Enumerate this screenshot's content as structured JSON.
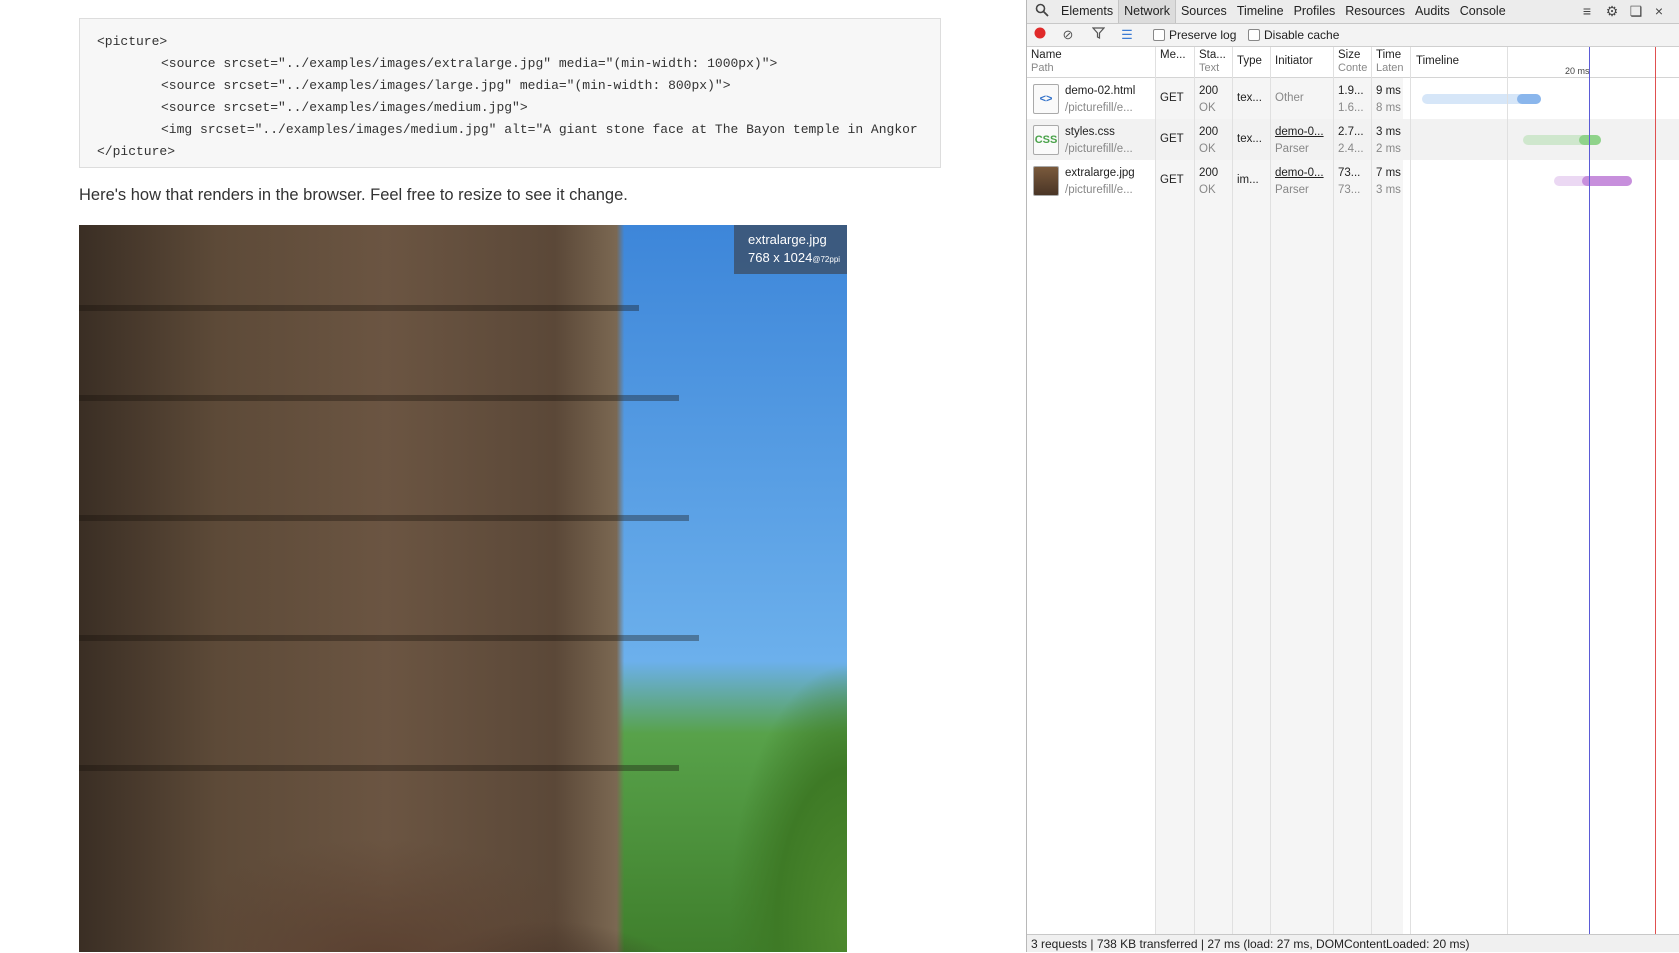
{
  "code_block": {
    "lines": [
      "<picture>",
      "<source srcset=\"../examples/images/extralarge.jpg\" media=\"(min-width: 1000px)\">",
      "<source srcset=\"../examples/images/large.jpg\" media=\"(min-width: 800px)\">",
      "<source srcset=\"../examples/images/medium.jpg\">",
      "<img srcset=\"../examples/images/medium.jpg\" alt=\"A giant stone face at The Bayon temple in Angkor",
      "</picture>"
    ]
  },
  "caption": "Here's how that renders in the browser. Feel free to resize to see it change.",
  "image_badge": {
    "filename": "extralarge.jpg",
    "dimensions": "768 x 1024",
    "ppi": "@72ppi"
  },
  "devtools": {
    "tabs": [
      "Elements",
      "Network",
      "Sources",
      "Timeline",
      "Profiles",
      "Resources",
      "Audits",
      "Console"
    ],
    "active_tab": "Network",
    "icons": {
      "search": "magnifier-icon",
      "drawer": "show-drawer-icon",
      "settings": "gear-icon",
      "dock": "dock-icon",
      "close": "close-icon"
    },
    "filter_bar": {
      "preserve_log": "Preserve log",
      "disable_cache": "Disable cache"
    },
    "columns": [
      {
        "main": "Name",
        "sub": "Path"
      },
      {
        "main": "Me...",
        "sub": ""
      },
      {
        "main": "Sta...",
        "sub": "Text"
      },
      {
        "main": "Type",
        "sub": ""
      },
      {
        "main": "Initiator",
        "sub": ""
      },
      {
        "main": "Size",
        "sub": "Conte"
      },
      {
        "main": "Time",
        "sub": "Laten"
      },
      {
        "main": "Timeline",
        "sub": ""
      }
    ],
    "timeline_tick": "20 ms",
    "rows": [
      {
        "name": "demo-02.html",
        "path": "/picturefill/e...",
        "method": "GET",
        "status": "200",
        "status_text": "OK",
        "type": "tex...",
        "initiator": "Other",
        "initiator_sub": "",
        "size": "1.9...",
        "content": "1.6...",
        "time": "9 ms",
        "latency": "8 ms",
        "icon": "html-file-icon",
        "icon_glyph": "<>",
        "bar_color": "#8ab6ec",
        "bar_fraction": 0.52
      },
      {
        "name": "styles.css",
        "path": "/picturefill/e...",
        "method": "GET",
        "status": "200",
        "status_text": "OK",
        "type": "tex...",
        "initiator": "demo-0...",
        "initiator_sub": "Parser",
        "size": "2.7...",
        "content": "2.4...",
        "time": "3 ms",
        "latency": "2 ms",
        "icon": "css-file-icon",
        "icon_glyph": "CSS",
        "bar_color": "#8fd38a",
        "bar_fraction": 0.77
      },
      {
        "name": "extralarge.jpg",
        "path": "/picturefill/e...",
        "method": "GET",
        "status": "200",
        "status_text": "OK",
        "type": "im...",
        "initiator": "demo-0...",
        "initiator_sub": "Parser",
        "size": "73...",
        "content": "73...",
        "time": "7 ms",
        "latency": "3 ms",
        "icon": "image-file-icon",
        "icon_glyph": "",
        "bar_color": "#c78fdc",
        "bar_fraction": 0.9
      }
    ],
    "status_bar": "3 requests | 738 KB transferred | 27 ms (load: 27 ms, DOMContentLoaded: 20 ms)"
  }
}
